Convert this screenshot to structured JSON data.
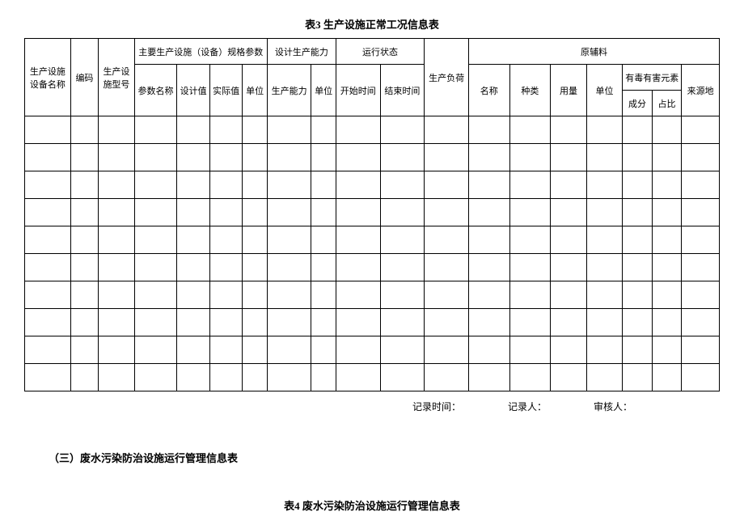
{
  "table3": {
    "caption": "表3  生产设施正常工况信息表",
    "headers": {
      "facility_name": "生产设施设备名称",
      "code": "编码",
      "model": "生产设施型号",
      "spec_group": "主要生产设施（设备）规格参数",
      "spec_param_name": "参数名称",
      "spec_design_value": "设计值",
      "spec_actual_value": "实际值",
      "spec_unit": "单位",
      "capacity_group": "设计生产能力",
      "capacity_value": "生产能力",
      "capacity_unit": "单位",
      "status_group": "运行状态",
      "status_start": "开始时间",
      "status_end": "结束时间",
      "load": "生产负荷",
      "material_group": "原辅料",
      "material_name": "名称",
      "material_type": "种类",
      "material_amount": "用量",
      "material_unit": "单位",
      "harmful_group": "有毒有害元素",
      "harmful_component": "成分",
      "harmful_ratio": "占比",
      "material_source": "来源地"
    },
    "empty_rows": 10
  },
  "footer": {
    "record_time": "记录时间：",
    "recorder": "记录人：",
    "reviewer": "审核人："
  },
  "section3": {
    "heading": "（三）废水污染防治设施运行管理信息表"
  },
  "table4": {
    "caption": "表4  废水污染防治设施运行管理信息表"
  }
}
